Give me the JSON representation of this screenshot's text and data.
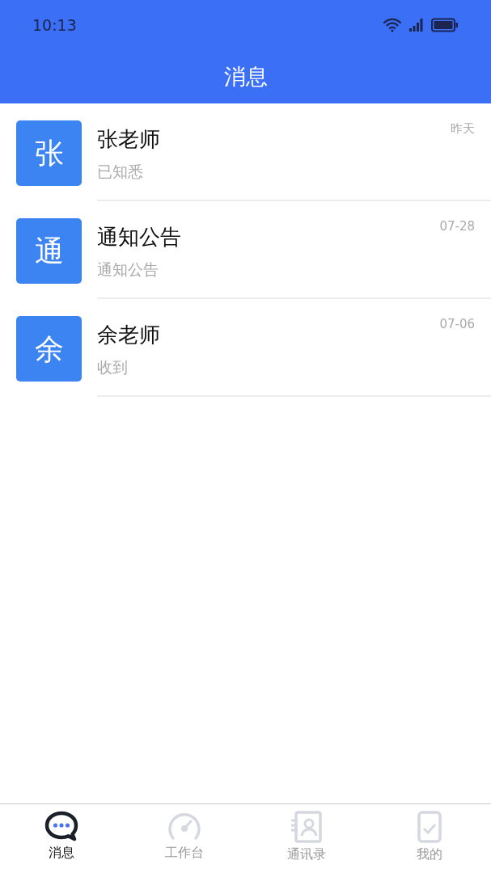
{
  "status_bar": {
    "time": "10:13"
  },
  "header": {
    "title": "消息"
  },
  "messages": [
    {
      "avatar": "张",
      "name": "张老师",
      "preview": "已知悉",
      "time": "昨天"
    },
    {
      "avatar": "通",
      "name": "通知公告",
      "preview": "通知公告",
      "time": "07-28"
    },
    {
      "avatar": "余",
      "name": "余老师",
      "preview": "收到",
      "time": "07-06"
    }
  ],
  "tabs": [
    {
      "label": "消息",
      "kind": "chat",
      "selected": true
    },
    {
      "label": "工作台",
      "kind": "gauge",
      "selected": false
    },
    {
      "label": "通讯录",
      "kind": "contacts",
      "selected": false
    },
    {
      "label": "我的",
      "kind": "profile",
      "selected": false
    }
  ]
}
